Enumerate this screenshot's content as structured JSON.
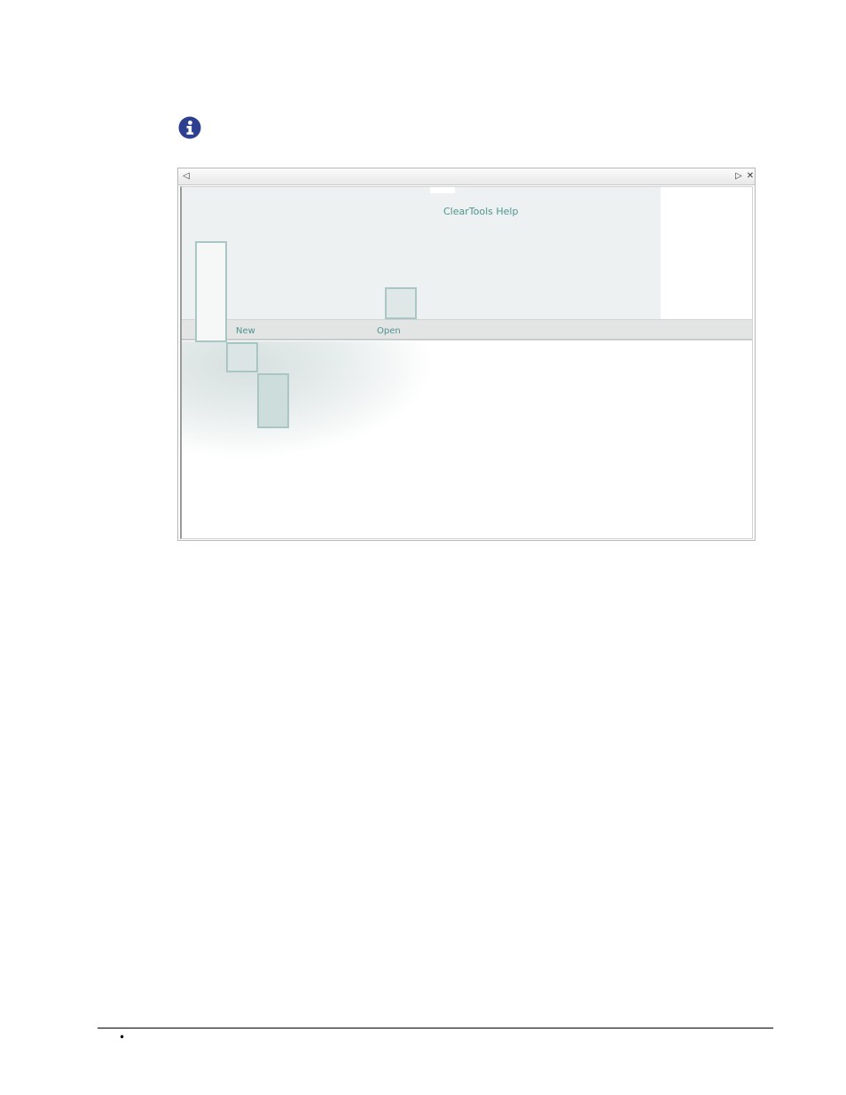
{
  "note": {
    "icon": "info-icon",
    "color": "#2f3f8f"
  },
  "window": {
    "controls": {
      "back_icon": "triangle-left-icon",
      "forward_icon": "triangle-right-icon",
      "close_icon": "close-icon",
      "back_glyph": "◁",
      "forward_glyph": "▷",
      "close_glyph": "✕"
    },
    "page": {
      "title": "ClearTools Help",
      "menu": [
        {
          "label": "New"
        },
        {
          "label": "Open"
        }
      ],
      "accent_color": "#4f948f"
    }
  },
  "footer": {
    "bullet": "•"
  }
}
